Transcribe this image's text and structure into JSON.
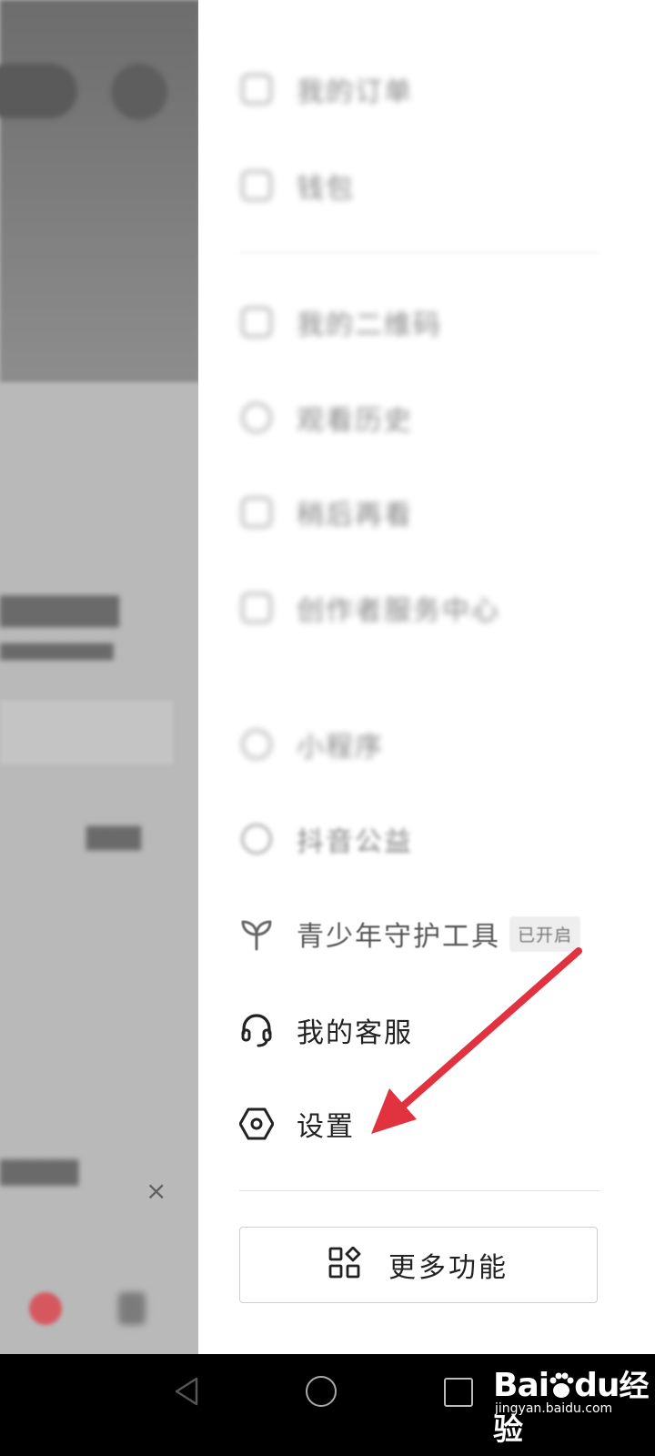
{
  "background_app": {
    "close_glyph": "×"
  },
  "drawer": {
    "items": [
      {
        "label": "我的订单"
      },
      {
        "label": "钱包"
      },
      {
        "label": "我的二维码"
      },
      {
        "label": "观看历史"
      },
      {
        "label": "稍后再看"
      },
      {
        "label": "创作者服务中心"
      },
      {
        "label": "小程序"
      },
      {
        "label": "抖音公益"
      },
      {
        "label": "青少年守护工具",
        "badge": "已开启"
      },
      {
        "label": "我的客服"
      },
      {
        "label": "设置"
      }
    ],
    "more_button": {
      "label": "更多功能"
    }
  },
  "watermark": {
    "logo": "Bai",
    "logo_tail": "du",
    "text": "经验",
    "url": "jingyan.baidu.com"
  },
  "colors": {
    "arrow": "#e0333f",
    "drawer_bg": "#ffffff",
    "navbar": "#000000"
  }
}
